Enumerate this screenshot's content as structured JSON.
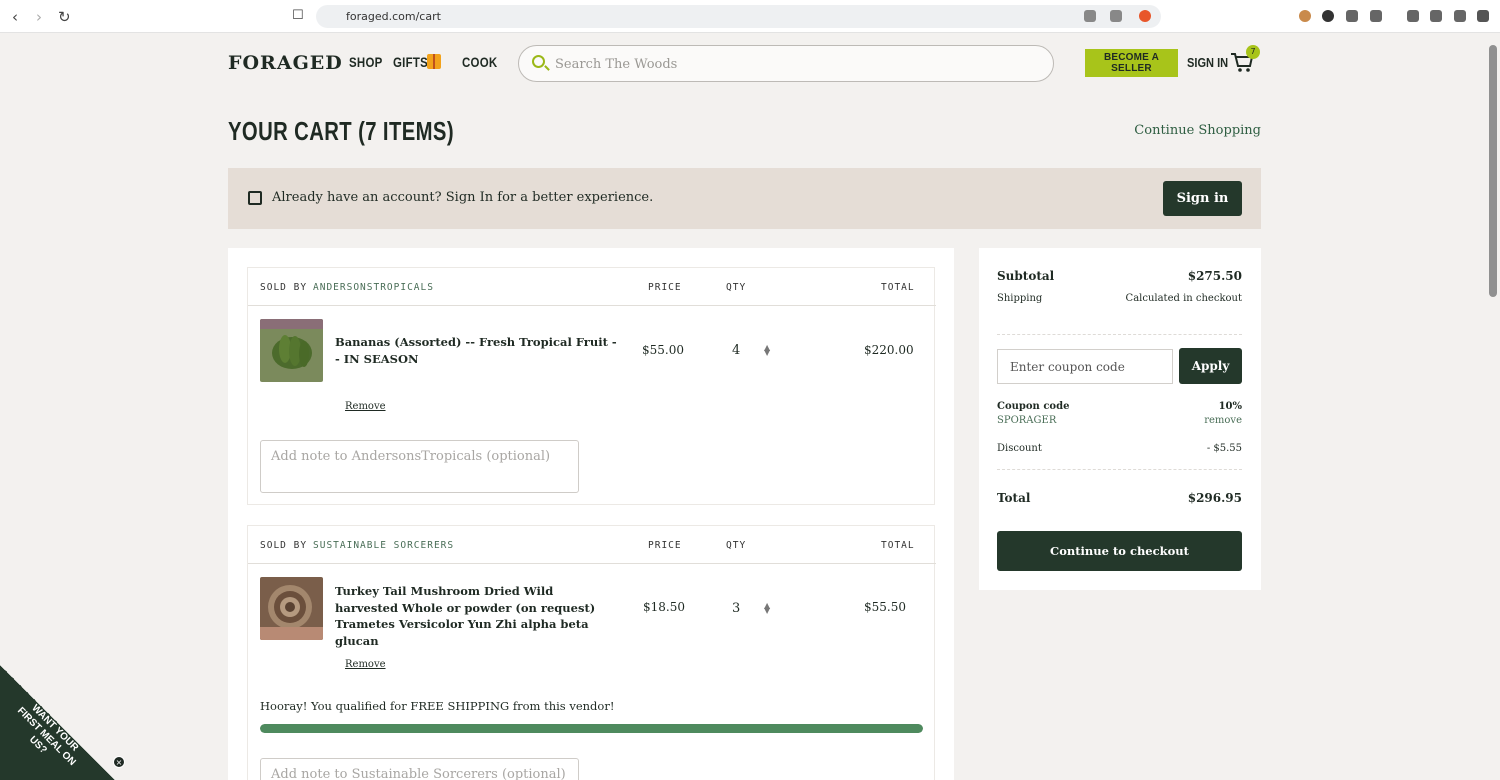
{
  "browser": {
    "url": "foraged.com/cart",
    "tab_icon": "brave-shield-icon"
  },
  "header": {
    "logo": "FORAGED",
    "nav": [
      {
        "label": "SHOP"
      },
      {
        "label": "GIFTS"
      },
      {
        "label": "COOK"
      }
    ],
    "search_placeholder": "Search The Woods",
    "become_seller": "BECOME A SELLER",
    "sign_in": "SIGN IN",
    "cart_count": "7"
  },
  "page": {
    "title": "YOUR CART (7 ITEMS)",
    "continue_shopping": "Continue Shopping"
  },
  "banner": {
    "text": "Already have an account? Sign In for a better experience.",
    "button": "Sign in"
  },
  "vendors": [
    {
      "sold_by_label": "SOLD BY",
      "name": "ANDERSONSTROPICALS",
      "price_header": "PRICE",
      "qty_header": "QTY",
      "total_header": "TOTAL",
      "item": {
        "name": "Bananas (Assorted) -- Fresh Tropical Fruit -- IN SEASON",
        "price": "$55.00",
        "qty": "4",
        "total": "$220.00",
        "remove": "Remove"
      },
      "note_placeholder": "Add note to AndersonsTropicals (optional)"
    },
    {
      "sold_by_label": "SOLD BY",
      "name": "SUSTAINABLE SORCERERS",
      "price_header": "PRICE",
      "qty_header": "QTY",
      "total_header": "TOTAL",
      "item": {
        "name": "Turkey Tail Mushroom Dried Wild harvested Whole or powder (on request) Trametes Versicolor Yun Zhi alpha beta glucan",
        "price": "$18.50",
        "qty": "3",
        "total": "$55.50",
        "remove": "Remove"
      },
      "free_shipping": "Hooray! You qualified for FREE SHIPPING from this vendor!",
      "free_shipping_progress": 1.0,
      "note_placeholder": "Add note to Sustainable Sorcerers (optional)"
    }
  ],
  "summary": {
    "subtotal_label": "Subtotal",
    "subtotal": "$275.50",
    "shipping_label": "Shipping",
    "shipping": "Calculated in checkout",
    "coupon_placeholder": "Enter coupon code",
    "apply": "Apply",
    "coupon_code_label": "Coupon code",
    "coupon_code": "SPORAGER",
    "coupon_percent": "10%",
    "coupon_remove": "remove",
    "discount_label": "Discount",
    "discount": "- $5.55",
    "total_label": "Total",
    "total": "$296.95",
    "checkout": "Continue to checkout"
  },
  "promo": {
    "text": "WANT YOUR FIRST MEAL ON US?",
    "close": "×"
  },
  "colors": {
    "brand_dark": "#24382b",
    "accent_lime": "#a8c41a",
    "banner_bg": "#e5ddd6",
    "progress": "#4e8a5e"
  }
}
